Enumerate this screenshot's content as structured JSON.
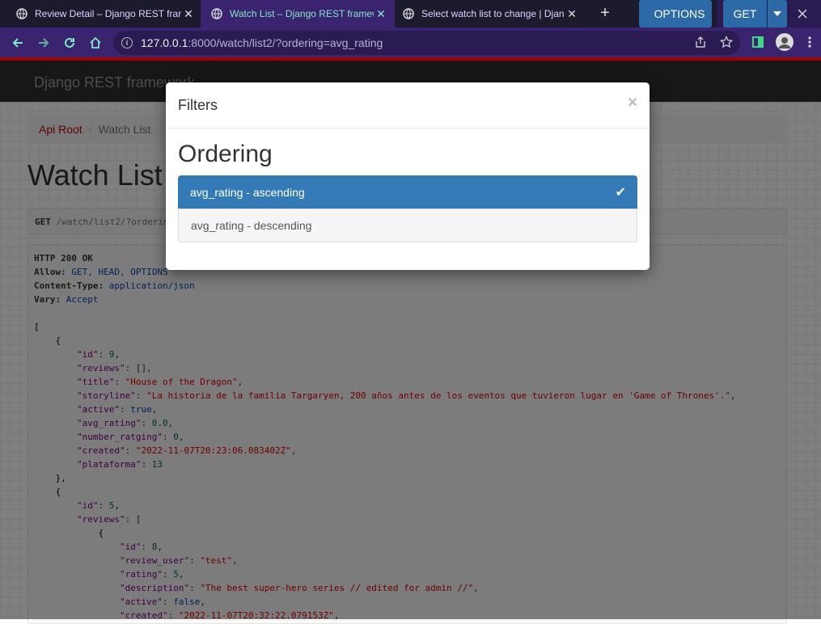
{
  "browser": {
    "tabs": [
      {
        "title": "Review Detail – Django REST framework"
      },
      {
        "title": "Watch List – Django REST framework"
      },
      {
        "title": "Select watch list to change | Django site admin"
      }
    ],
    "close_glyph": "✕",
    "new_tab_glyph": "+",
    "url_host": "127.0.0.1",
    "url_rest": ":8000/watch/list2/?ordering=avg_rating"
  },
  "navbar": {
    "brand": "Django REST framework"
  },
  "breadcrumb": {
    "root": "Api Root",
    "sep": "/",
    "current": "Watch List"
  },
  "page": {
    "title": "Watch List",
    "options_label": "OPTIONS",
    "get_label": "GET"
  },
  "request": {
    "method": "GET",
    "url": " /watch/list2/?ordering=avg_rating"
  },
  "response": {
    "status": "HTTP 200 OK",
    "allow_key": "Allow:",
    "allow_val": " GET, HEAD, OPTIONS",
    "ctype_key": "Content-Type:",
    "ctype_val": " application/json",
    "vary_key": "Vary:",
    "vary_val": " Accept",
    "items": [
      {
        "id": "9",
        "title": "\"House of the Dragon\"",
        "storyline": "\"La historia de la familia Targaryen, 200 años antes de los eventos que tuvieron lugar en 'Game of Thrones'.\"",
        "active": "true",
        "avg_rating": "0.0",
        "number_ratging": "0",
        "created": "\"2022-11-07T20:23:06.083402Z\"",
        "plataforma": "13"
      },
      {
        "id": "5",
        "review_id": "8",
        "review_user": "\"test\"",
        "rating": "5",
        "description": "\"The best super-hero series // edited for admin //\"",
        "active": "false",
        "created": "\"2022-11-07T20:32:22.079153Z\""
      }
    ]
  },
  "modal": {
    "title": "Filters",
    "close": "×",
    "heading": "Ordering",
    "options": [
      {
        "label": "avg_rating - ascending",
        "selected": true
      },
      {
        "label": "avg_rating - descending",
        "selected": false
      }
    ],
    "check": "✔"
  },
  "colors": {
    "tabbar": "#1c1b2e",
    "toolbar": "#3a246f",
    "accent": "#7fe8c8",
    "primary": "#337ab7",
    "brand_red": "#a30000"
  }
}
